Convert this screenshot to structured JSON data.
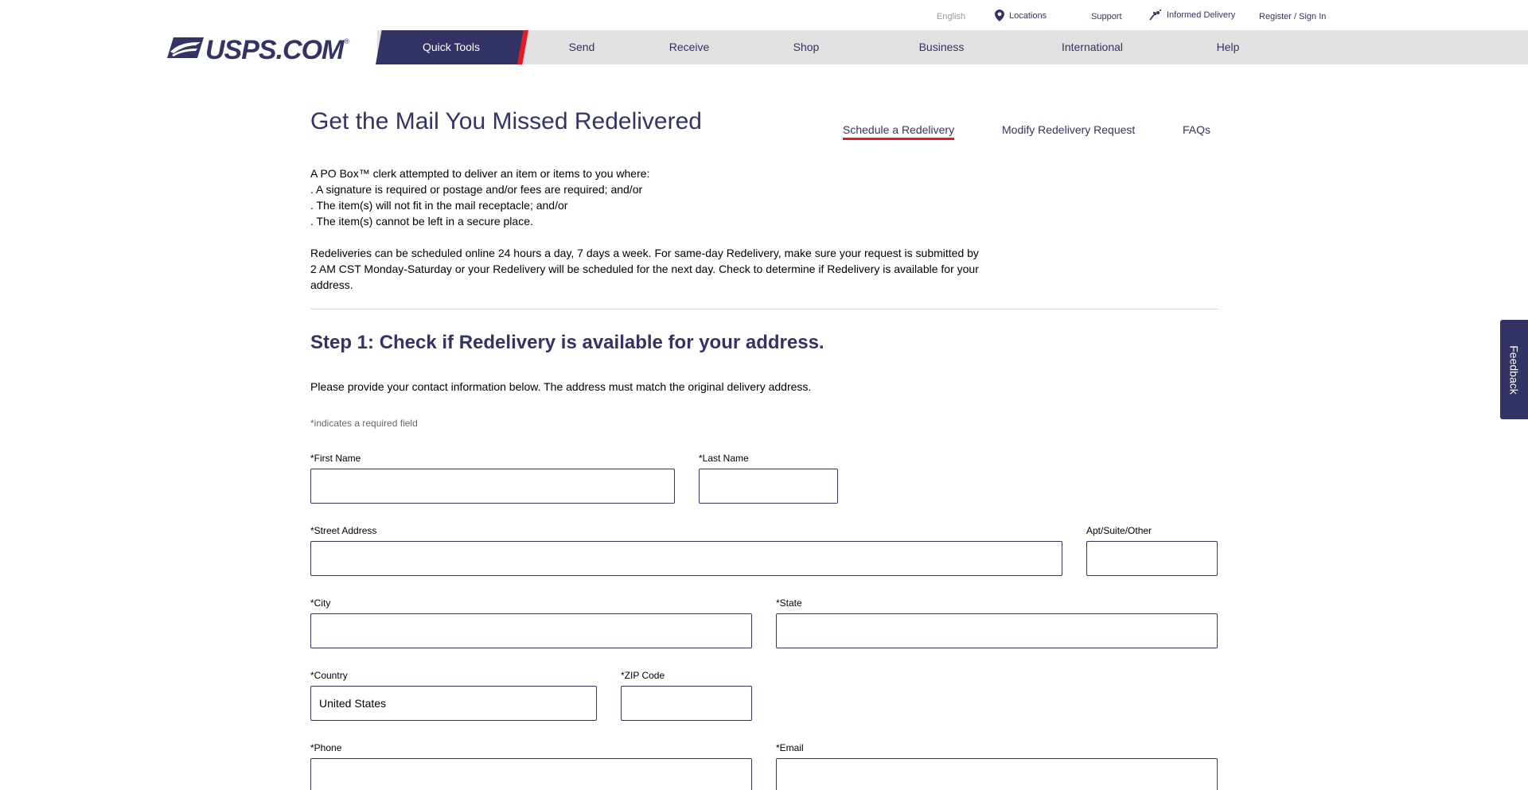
{
  "utility": {
    "language": "English",
    "locations": "Locations",
    "support": "Support",
    "informed_delivery": "Informed Delivery",
    "register": "Register / Sign In"
  },
  "logo": {
    "text": "USPS.COM",
    "mark": "®"
  },
  "nav": {
    "quick_tools": "Quick Tools",
    "items": [
      "Send",
      "Receive",
      "Shop",
      "Business",
      "International",
      "Help"
    ]
  },
  "page": {
    "title": "Get the Mail You Missed Redelivered",
    "subnav": [
      "Schedule a Redelivery",
      "Modify Redelivery Request",
      "FAQs"
    ]
  },
  "intro": {
    "lines": [
      "A PO Box™ clerk attempted to deliver an item or items to you where:",
      ". A signature is required or postage and/or fees are required; and/or",
      ". The item(s) will not fit in the mail receptacle; and/or",
      ". The item(s) cannot be left in a secure place."
    ],
    "paragraph": "Redeliveries can be scheduled online 24 hours a day, 7 days a week. For same-day Redelivery, make sure your request is submitted by 2 AM CST Monday-Saturday or your Redelivery will be scheduled for the next day. Check to determine if Redelivery is available for your address."
  },
  "step": {
    "prefix": "Step 1:",
    "title": "Check if Redelivery is available for your address."
  },
  "form": {
    "instruction": "Please provide your contact information below. The address must match the original delivery address.",
    "required_note": "*indicates a required field",
    "first_name": {
      "label": "*First Name",
      "value": ""
    },
    "last_name": {
      "label": "*Last Name",
      "value": ""
    },
    "street": {
      "label": "*Street Address",
      "value": ""
    },
    "apt": {
      "label": "Apt/Suite/Other",
      "value": ""
    },
    "city": {
      "label": "*City",
      "value": ""
    },
    "state": {
      "label": "*State",
      "value": ""
    },
    "country": {
      "label": "*Country",
      "value": "United States"
    },
    "zip": {
      "label": "*ZIP Code",
      "value": ""
    },
    "phone": {
      "label": "*Phone",
      "value": ""
    },
    "email": {
      "label": "*Email",
      "value": ""
    }
  },
  "feedback": "Feedback",
  "colors": {
    "brand_navy": "#333366",
    "brand_red": "#e71921",
    "nav_gray": "#e1e1e1"
  }
}
